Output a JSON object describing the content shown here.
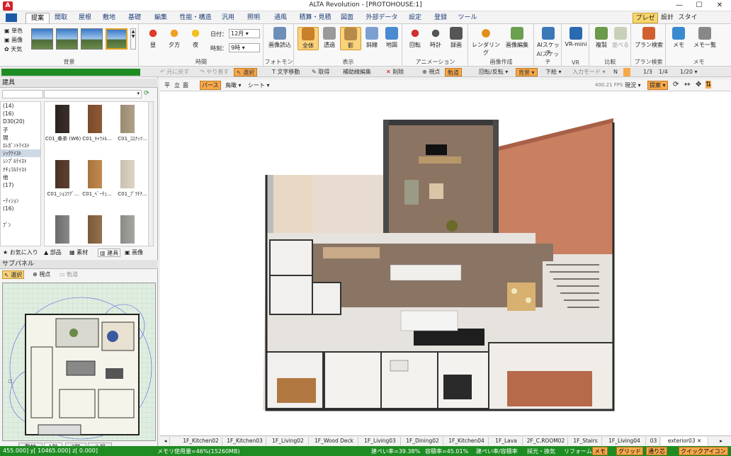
{
  "window": {
    "title": "ALTA Revolution - [PROTOHOUSE:1]",
    "app_icon_letter": "A"
  },
  "menu": {
    "tabs": [
      "提案",
      "間取",
      "屋根",
      "敷地",
      "基礎",
      "編集",
      "性能・構造",
      "汎用",
      "照明",
      "通風",
      "積算・見積",
      "図面",
      "外部データ",
      "設定",
      "登録",
      "ツール"
    ],
    "right": [
      "プレゼン",
      "設計",
      "スタイル"
    ]
  },
  "ribbon": {
    "background_options": [
      "単色",
      "画像",
      "天気"
    ],
    "groups": {
      "background": "背景",
      "time": "時間",
      "photomontage": "フォトモン",
      "display": "表示",
      "animation": "アニメーション",
      "image_creation": "画像作成",
      "ai_sketch": "AIスケッチ",
      "vr": "VR",
      "compare": "比較",
      "plan_search": "プラン検索",
      "memo": "メモ"
    },
    "time_buttons": [
      "昼",
      "夕方",
      "夜"
    ],
    "date_label": "日付：",
    "date_value": "12月",
    "time_label": "時刻：",
    "time_value": "9時",
    "photomontage_btn": "画像読込",
    "display_buttons": [
      "全体",
      "透過",
      "影",
      "斜線",
      "地図"
    ],
    "animation_buttons": [
      "回転",
      "時計",
      "録画"
    ],
    "image_buttons": [
      "レンダリング",
      "画像編集"
    ],
    "ai_btn": "AIスケッチ",
    "vr_btn": "VR-mini",
    "compare_buttons": [
      "複製",
      "並べる"
    ],
    "plan_btn": "プラン検索",
    "memo_buttons": [
      "メモ",
      "メモ一覧"
    ]
  },
  "toolbar": {
    "items": [
      "元に戻す",
      "やり直す",
      "選択",
      "文字移動",
      "取得",
      "補助線編集",
      "削除",
      "視点",
      "軌道",
      "回転/反転",
      "背景",
      "下絵",
      "入力モード",
      "N",
      "1/3",
      "1/4",
      "1/20"
    ]
  },
  "viewbar": {
    "items": [
      "平",
      "立",
      "面",
      "パース",
      "鳥",
      "瞰",
      "シート"
    ],
    "fps": "400.21 FPS",
    "mode": "現況",
    "proposal": "提案"
  },
  "left_panel": {
    "title": "建具",
    "categories": [
      "(14)",
      "(16)",
      "D30(20)",
      "子",
      "現",
      "ｴﾚｶﾞﾝﾄﾃｲｽﾄ",
      "ｼｯｸﾃｲｽﾄ",
      "ｼﾝﾌﾟﾙﾃｲｽﾄ",
      "ﾅﾁｭﾗﾙﾃｲｽﾄ",
      "他",
      "(17)",
      "",
      "ｰﾃｨｼｮﾝ",
      "(16)",
      "",
      "ﾌﾟﾝ"
    ],
    "items": [
      {
        "label": "C01_桑茶 (W6)"
      },
      {
        "label": "C01_ｷｬﾗﾒﾙ..."
      },
      {
        "label": "C01_ｺｺﾅｯﾂ..."
      },
      {
        "label": "C01_ｼｮｺﾗｸﾞ..."
      },
      {
        "label": "C01_ﾍﾞｰﾁｪ..."
      },
      {
        "label": "C01_ﾌﾟﾗﾁﾅ..."
      }
    ],
    "bottom_tabs": [
      "お気に入り",
      "部品",
      "素材",
      "建具",
      "画像"
    ]
  },
  "sub_panel": {
    "title": "サブパネル",
    "buttons": [
      "選択",
      "視点",
      "軌道"
    ],
    "floor_tabs": [
      "敷地",
      "1階",
      "2階",
      "小屋"
    ]
  },
  "view_tabs": [
    "1F_Kitchen02",
    "1F_Kitchen03",
    "1F_Living02",
    "1F_Wood Deck",
    "1F_Living03",
    "1F_Dining02",
    "1F_Kitchen04",
    "1F_Lava",
    "2F_C.ROOM02",
    "1F_Stairs",
    "1F_Living04",
    "03",
    "exterior03"
  ],
  "status": {
    "coords": "455.000] y[ 10465.000] z[   0.000]",
    "memory": "メモリ使用量=46%(15260MB)",
    "coverage": "建ぺい率=39.38%",
    "floor_area": "容積率=45.01%",
    "ratio": "建ぺい率/容積率",
    "daylight": "採光・換気",
    "reform": "リフォーム",
    "buttons": [
      "メモ",
      "グリッド",
      "通り芯",
      "クイックアイコン"
    ]
  },
  "colors": {
    "accent": "#1e8c22",
    "brand": "#d6202a",
    "highlight": "#f6a84b"
  }
}
